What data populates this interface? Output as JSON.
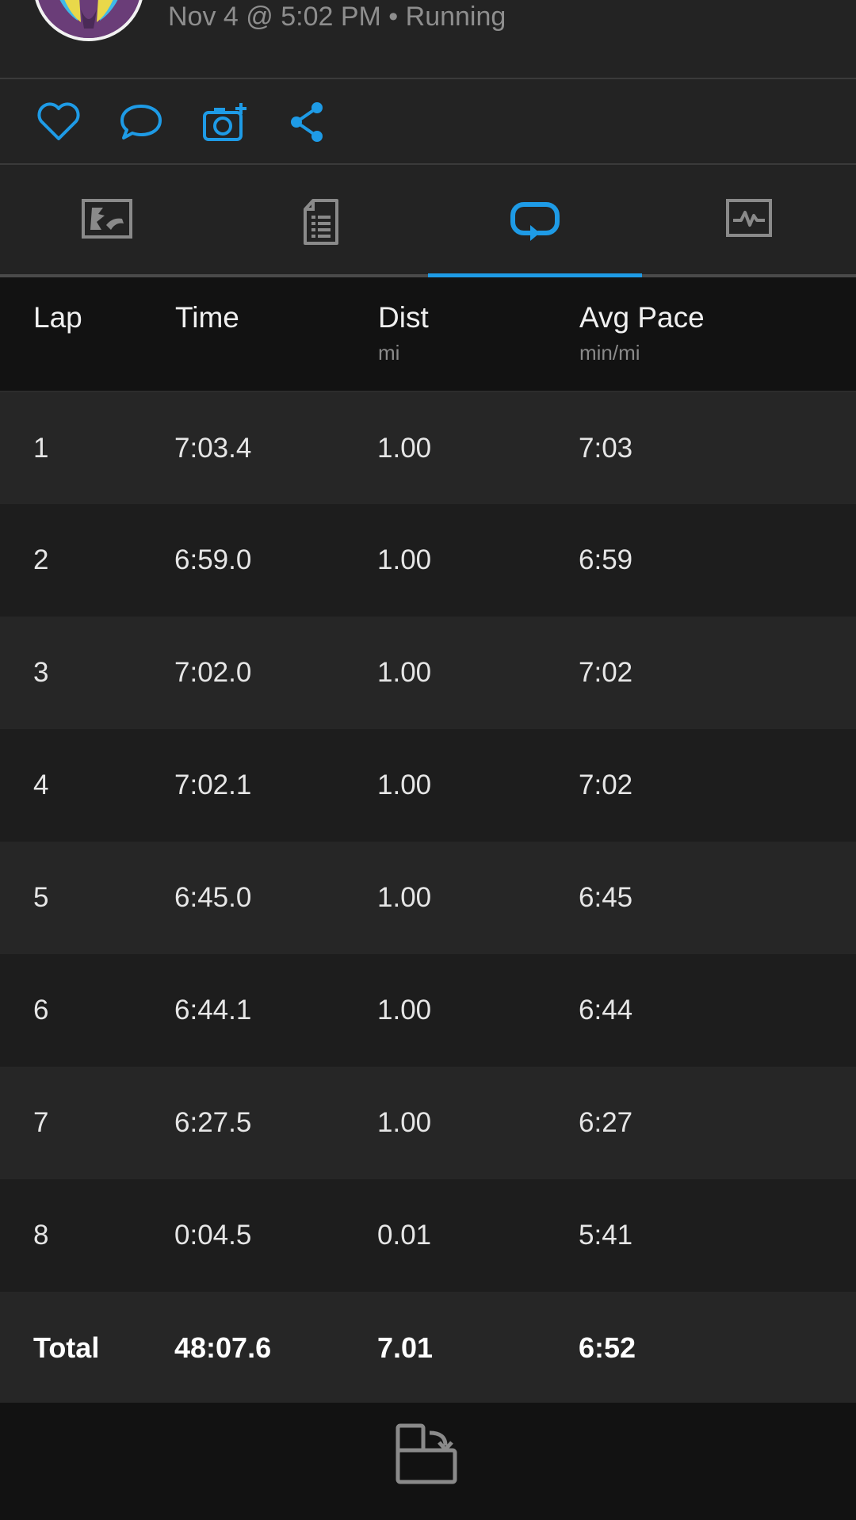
{
  "header": {
    "subtitle": "Nov 4 @ 5:02 PM • Running"
  },
  "actions": {
    "icons": [
      "heart-icon",
      "comment-icon",
      "add-photo-icon",
      "share-icon"
    ]
  },
  "tabs": {
    "icons": [
      "map-icon",
      "details-icon",
      "laps-icon",
      "charts-icon"
    ],
    "active_index": 2,
    "accent_color": "#1e9be6"
  },
  "table": {
    "headers": {
      "lap": "Lap",
      "time": "Time",
      "dist": "Dist",
      "dist_unit": "mi",
      "pace": "Avg Pace",
      "pace_unit": "min/mi"
    },
    "rows": [
      {
        "lap": "1",
        "time": "7:03.4",
        "dist": "1.00",
        "pace": "7:03"
      },
      {
        "lap": "2",
        "time": "6:59.0",
        "dist": "1.00",
        "pace": "6:59"
      },
      {
        "lap": "3",
        "time": "7:02.0",
        "dist": "1.00",
        "pace": "7:02"
      },
      {
        "lap": "4",
        "time": "7:02.1",
        "dist": "1.00",
        "pace": "7:02"
      },
      {
        "lap": "5",
        "time": "6:45.0",
        "dist": "1.00",
        "pace": "6:45"
      },
      {
        "lap": "6",
        "time": "6:44.1",
        "dist": "1.00",
        "pace": "6:44"
      },
      {
        "lap": "7",
        "time": "6:27.5",
        "dist": "1.00",
        "pace": "6:27"
      },
      {
        "lap": "8",
        "time": "0:04.5",
        "dist": "0.01",
        "pace": "5:41"
      }
    ],
    "total": {
      "lap": "Total",
      "time": "48:07.6",
      "dist": "7.01",
      "pace": "6:52"
    }
  },
  "footer": {
    "icon": "rotate-screen-icon"
  }
}
